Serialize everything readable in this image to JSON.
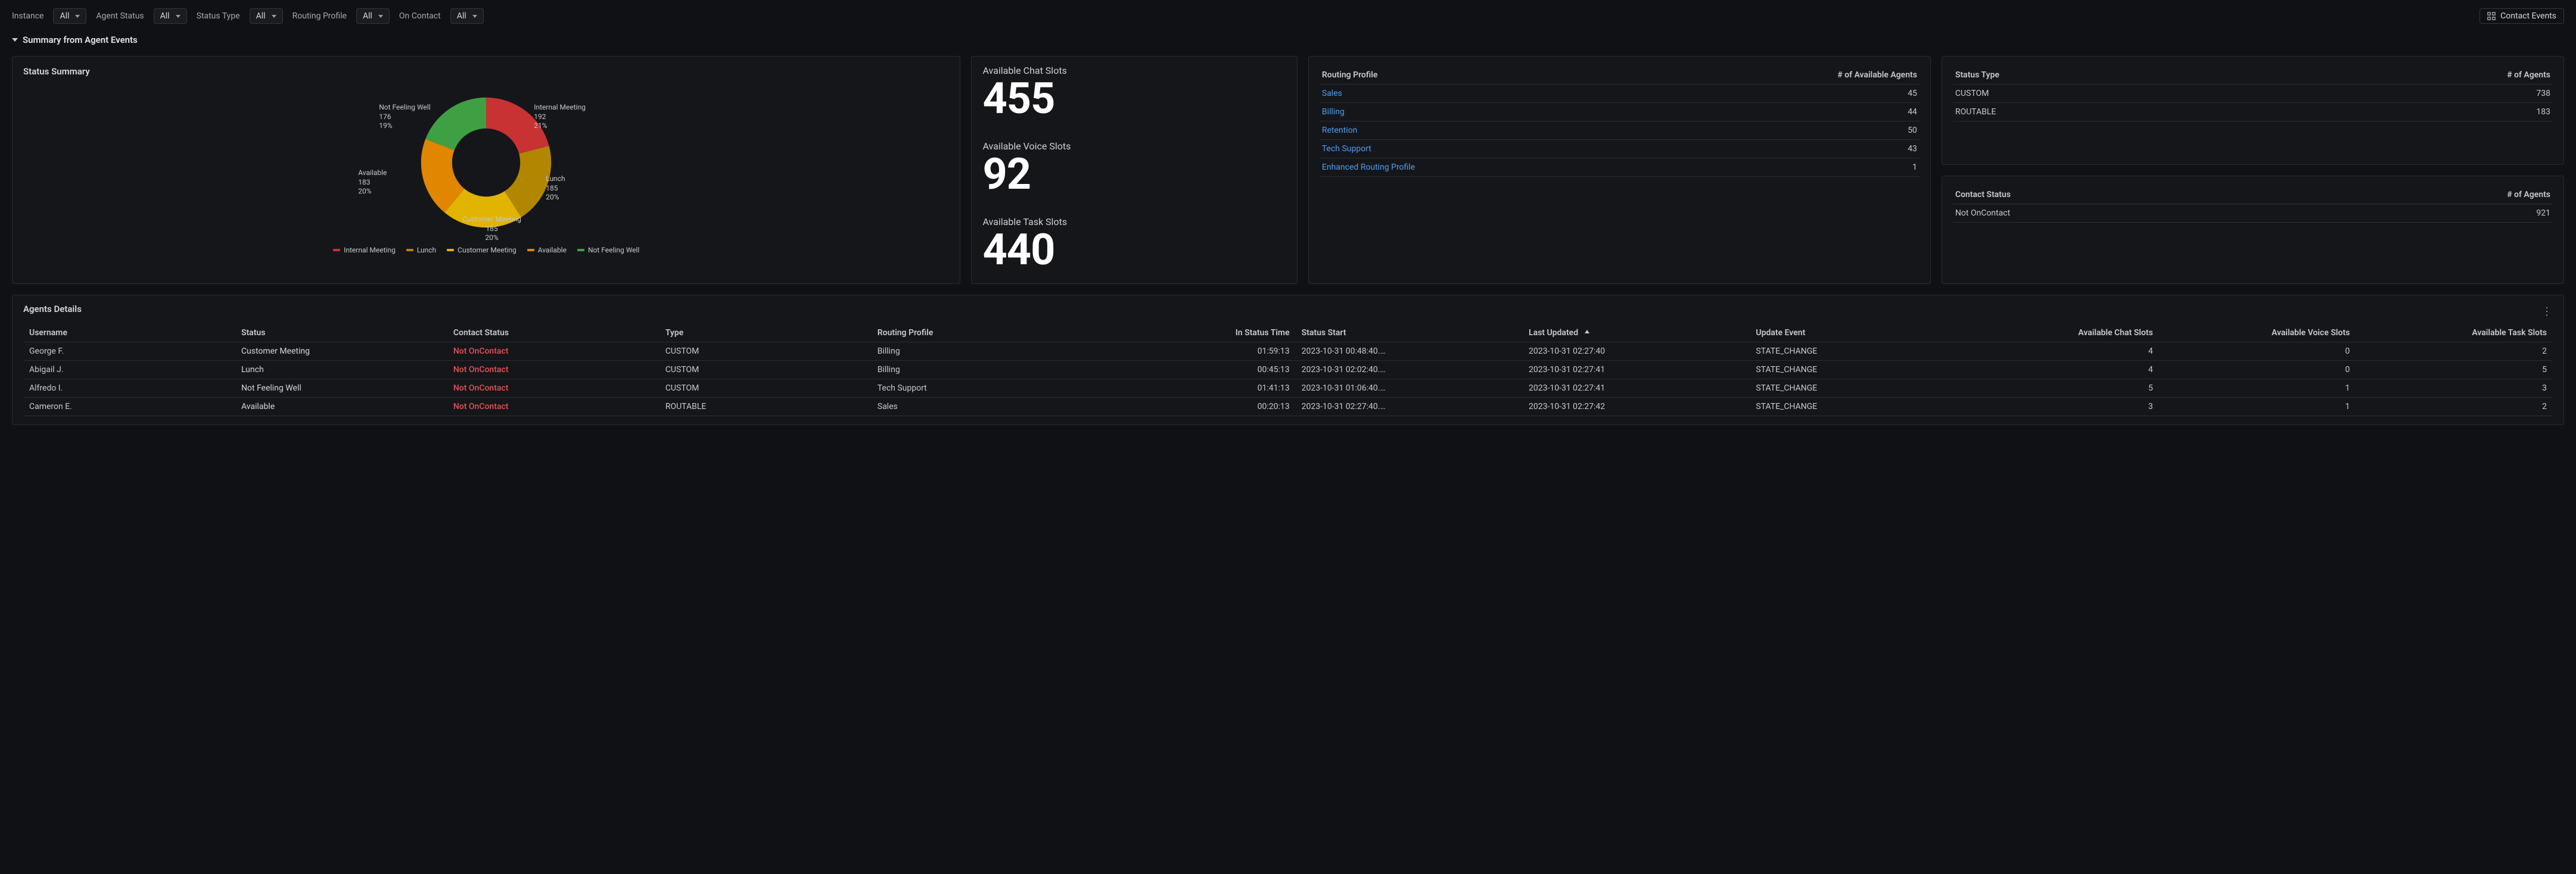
{
  "colors": {
    "accent_blue": "#4c9ef0",
    "red": "#c83232",
    "green": "#3ea043",
    "yellow_dark": "#b38600",
    "yellow": "#e0b400",
    "orange": "#e08600"
  },
  "filters": [
    {
      "label": "Instance",
      "value": "All"
    },
    {
      "label": "Agent Status",
      "value": "All"
    },
    {
      "label": "Status Type",
      "value": "All"
    },
    {
      "label": "Routing Profile",
      "value": "All"
    },
    {
      "label": "On Contact",
      "value": "All"
    }
  ],
  "header_buttons": {
    "contact_events": "Contact Events"
  },
  "summary_toggle": "Summary from Agent Events",
  "status_summary": {
    "title": "Status Summary",
    "legend": [
      {
        "name": "Internal Meeting",
        "color": "#c83232"
      },
      {
        "name": "Lunch",
        "color": "#b38600"
      },
      {
        "name": "Customer Meeting",
        "color": "#e0b400"
      },
      {
        "name": "Available",
        "color": "#e08600"
      },
      {
        "name": "Not Feeling Well",
        "color": "#3ea043"
      }
    ]
  },
  "chart_data": {
    "type": "pie",
    "title": "Status Summary",
    "slices": [
      {
        "label": "Internal Meeting",
        "value": 192,
        "percent": 21,
        "color": "#c83232"
      },
      {
        "label": "Lunch",
        "value": 185,
        "percent": 20,
        "color": "#b38600"
      },
      {
        "label": "Customer Meeting",
        "value": 185,
        "percent": 20,
        "color": "#e0b400"
      },
      {
        "label": "Available",
        "value": 183,
        "percent": 20,
        "color": "#e08600"
      },
      {
        "label": "Not Feeling Well",
        "value": 176,
        "percent": 19,
        "color": "#3ea043"
      }
    ],
    "annotation_labels": [
      "Internal Meeting\n192\n21%",
      "Lunch\n185\n20%",
      "Customer Meeting\n185\n20%",
      "Available\n183\n20%",
      "Not Feeling Well\n176\n19%"
    ]
  },
  "slots": {
    "chat": {
      "label": "Available Chat Slots",
      "value": "455"
    },
    "voice": {
      "label": "Available Voice Slots",
      "value": "92"
    },
    "task": {
      "label": "Available Task Slots",
      "value": "440"
    }
  },
  "routing_profile_table": {
    "col_profile": "Routing Profile",
    "col_count": "# of Available Agents",
    "rows": [
      {
        "name": "Sales",
        "count": "45"
      },
      {
        "name": "Billing",
        "count": "44"
      },
      {
        "name": "Retention",
        "count": "50"
      },
      {
        "name": "Tech Support",
        "count": "43"
      },
      {
        "name": "Enhanced Routing Profile",
        "count": "1"
      }
    ]
  },
  "status_type_table": {
    "col_type": "Status Type",
    "col_count": "# of Agents",
    "rows": [
      {
        "name": "CUSTOM",
        "count": "738"
      },
      {
        "name": "ROUTABLE",
        "count": "183"
      }
    ]
  },
  "contact_status_table": {
    "col_status": "Contact Status",
    "col_count": "# of Agents",
    "rows": [
      {
        "name": "Not OnContact",
        "count": "921"
      }
    ]
  },
  "agents_details": {
    "title": "Agents Details",
    "columns": {
      "username": "Username",
      "status": "Status",
      "contact_status": "Contact Status",
      "type": "Type",
      "routing_profile": "Routing Profile",
      "in_status_time": "In Status Time",
      "status_start": "Status Start",
      "last_updated": "Last Updated",
      "update_event": "Update Event",
      "chat": "Available Chat Slots",
      "voice": "Available Voice Slots",
      "task": "Available Task Slots"
    },
    "rows": [
      {
        "username": "George F.",
        "status": "Customer Meeting",
        "contact_status": "Not OnContact",
        "type": "CUSTOM",
        "routing_profile": "Billing",
        "in_status_time": "01:59:13",
        "status_start": "2023-10-31 00:48:40.…",
        "last_updated": "2023-10-31 02:27:40",
        "update_event": "STATE_CHANGE",
        "chat": "4",
        "voice": "0",
        "task": "2"
      },
      {
        "username": "Abigail J.",
        "status": "Lunch",
        "contact_status": "Not OnContact",
        "type": "CUSTOM",
        "routing_profile": "Billing",
        "in_status_time": "00:45:13",
        "status_start": "2023-10-31 02:02:40.…",
        "last_updated": "2023-10-31 02:27:41",
        "update_event": "STATE_CHANGE",
        "chat": "4",
        "voice": "0",
        "task": "5"
      },
      {
        "username": "Alfredo I.",
        "status": "Not Feeling Well",
        "contact_status": "Not OnContact",
        "type": "CUSTOM",
        "routing_profile": "Tech Support",
        "in_status_time": "01:41:13",
        "status_start": "2023-10-31 01:06:40.…",
        "last_updated": "2023-10-31 02:27:41",
        "update_event": "STATE_CHANGE",
        "chat": "5",
        "voice": "1",
        "task": "3"
      },
      {
        "username": "Cameron E.",
        "status": "Available",
        "contact_status": "Not OnContact",
        "type": "ROUTABLE",
        "routing_profile": "Sales",
        "in_status_time": "00:20:13",
        "status_start": "2023-10-31 02:27:40.…",
        "last_updated": "2023-10-31 02:27:42",
        "update_event": "STATE_CHANGE",
        "chat": "3",
        "voice": "1",
        "task": "2"
      }
    ]
  }
}
